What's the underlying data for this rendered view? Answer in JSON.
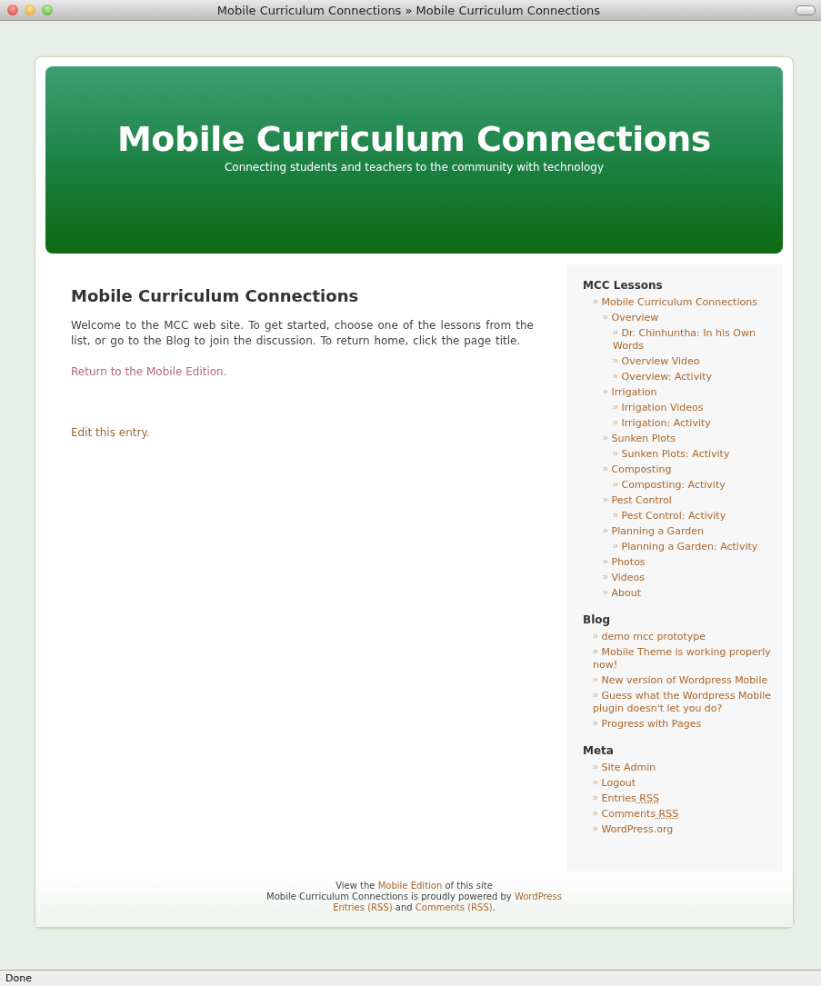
{
  "window": {
    "title": "Mobile Curriculum Connections » Mobile Curriculum Connections"
  },
  "header": {
    "title": "Mobile Curriculum Connections",
    "tagline": "Connecting students and teachers to the community with technology"
  },
  "post": {
    "title": "Mobile Curriculum Connections",
    "body": "Welcome to the MCC web site. To get started, choose one of the lessons from the list, or go to the Blog to join the discussion. To return home, click the page title.",
    "links": [
      {
        "label": "Return to the Mobile Edition.",
        "visited": true
      },
      {
        "label": "Edit this entry.",
        "visited": false
      }
    ]
  },
  "sidebar": [
    {
      "heading": "MCC Lessons",
      "items": [
        {
          "label": "Mobile Curriculum Connections",
          "children": [
            {
              "label": "Overview",
              "children": [
                {
                  "label": "Dr. Chinhuntha: In his Own Words"
                },
                {
                  "label": "Overview Video"
                },
                {
                  "label": "Overview: Activity"
                }
              ]
            },
            {
              "label": "Irrigation",
              "children": [
                {
                  "label": "Irrigation Videos"
                },
                {
                  "label": "Irrigation: Activity"
                }
              ]
            },
            {
              "label": "Sunken Plots",
              "children": [
                {
                  "label": "Sunken Plots: Activity"
                }
              ]
            },
            {
              "label": "Composting",
              "children": [
                {
                  "label": "Composting: Activity"
                }
              ]
            },
            {
              "label": "Pest Control",
              "children": [
                {
                  "label": "Pest Control: Activity"
                }
              ]
            },
            {
              "label": "Planning a Garden",
              "children": [
                {
                  "label": "Planning a Garden: Activity"
                }
              ]
            },
            {
              "label": "Photos"
            },
            {
              "label": "Videos"
            },
            {
              "label": "About"
            }
          ]
        }
      ]
    },
    {
      "heading": "Blog",
      "items": [
        {
          "label": "demo mcc prototype"
        },
        {
          "label": "Mobile Theme is working properly now!"
        },
        {
          "label": "New version of Wordpress Mobile"
        },
        {
          "label": "Guess what the Wordpress Mobile plugin doesn't let you do?"
        },
        {
          "label": "Progress with Pages"
        }
      ]
    },
    {
      "heading": "Meta",
      "items": [
        {
          "label": "Site Admin"
        },
        {
          "label": "Logout"
        },
        {
          "label": "Entries",
          "abbr": "RSS"
        },
        {
          "label": "Comments",
          "abbr": "RSS"
        },
        {
          "label": "WordPress.org"
        }
      ]
    }
  ],
  "footer": [
    [
      {
        "text": "View the "
      },
      {
        "text": "Mobile Edition",
        "link": true
      },
      {
        "text": " of this site"
      }
    ],
    [
      {
        "text": "Mobile Curriculum Connections is proudly powered by "
      },
      {
        "text": "WordPress",
        "link": true
      }
    ],
    [
      {
        "text": "Entries (RSS)",
        "link": true
      },
      {
        "text": " and "
      },
      {
        "text": "Comments (RSS)",
        "link": true
      },
      {
        "text": "."
      }
    ]
  ],
  "status_bar": "Done"
}
